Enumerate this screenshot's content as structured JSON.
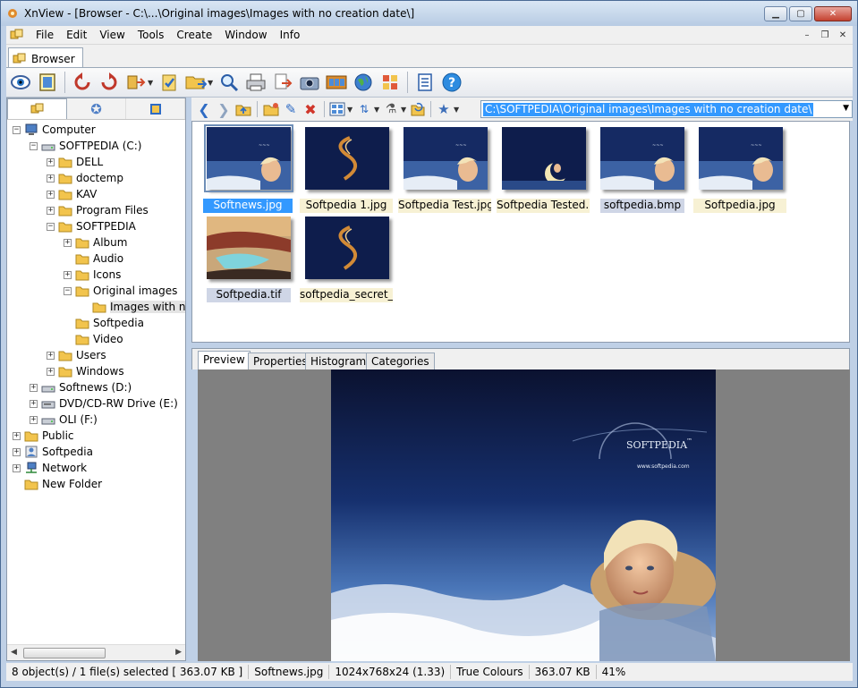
{
  "window": {
    "title": "XnView - [Browser - C:\\...\\Original images\\Images with no creation date\\]",
    "min_label": "▁",
    "max_label": "▢",
    "close_label": "✕"
  },
  "menu": [
    "File",
    "Edit",
    "View",
    "Tools",
    "Create",
    "Window",
    "Info"
  ],
  "doc_tab": {
    "label": "Browser"
  },
  "toolbar": {
    "buttons": [
      "eye-icon",
      "fullscreen-icon",
      "rotate-left-icon",
      "rotate-right-icon",
      "convert-icon",
      "checkmark-icon",
      "open-folder-icon",
      "zoom-icon",
      "print-icon",
      "export-icon",
      "camera-icon",
      "filmstrip-icon",
      "globe-icon",
      "mosaic-icon",
      "properties-icon",
      "help-icon"
    ]
  },
  "nav": {
    "path": "C:\\SOFTPEDIA\\Original images\\Images with no creation date\\"
  },
  "tree": [
    {
      "label": "Computer",
      "level": 0,
      "exp": "-",
      "icon": "computer-icon"
    },
    {
      "label": "SOFTPEDIA (C:)",
      "level": 1,
      "exp": "-",
      "icon": "drive-icon"
    },
    {
      "label": "DELL",
      "level": 2,
      "exp": "+",
      "icon": "folder-icon"
    },
    {
      "label": "doctemp",
      "level": 2,
      "exp": "+",
      "icon": "folder-icon"
    },
    {
      "label": "KAV",
      "level": 2,
      "exp": "+",
      "icon": "folder-icon"
    },
    {
      "label": "Program Files",
      "level": 2,
      "exp": "+",
      "icon": "folder-icon"
    },
    {
      "label": "SOFTPEDIA",
      "level": 2,
      "exp": "-",
      "icon": "folder-icon"
    },
    {
      "label": "Album",
      "level": 3,
      "exp": "+",
      "icon": "folder-icon"
    },
    {
      "label": "Audio",
      "level": 3,
      "exp": "",
      "icon": "folder-icon"
    },
    {
      "label": "Icons",
      "level": 3,
      "exp": "+",
      "icon": "folder-icon"
    },
    {
      "label": "Original images",
      "level": 3,
      "exp": "-",
      "icon": "folder-icon"
    },
    {
      "label": "Images with n",
      "level": 4,
      "exp": "",
      "icon": "folder-icon",
      "selected": true
    },
    {
      "label": "Softpedia",
      "level": 3,
      "exp": "",
      "icon": "folder-icon"
    },
    {
      "label": "Video",
      "level": 3,
      "exp": "",
      "icon": "folder-icon"
    },
    {
      "label": "Users",
      "level": 2,
      "exp": "+",
      "icon": "folder-icon"
    },
    {
      "label": "Windows",
      "level": 2,
      "exp": "+",
      "icon": "folder-icon"
    },
    {
      "label": "Softnews (D:)",
      "level": 1,
      "exp": "+",
      "icon": "drive-icon"
    },
    {
      "label": "DVD/CD-RW Drive (E:)",
      "level": 1,
      "exp": "+",
      "icon": "dvd-icon"
    },
    {
      "label": "OLI (F:)",
      "level": 1,
      "exp": "+",
      "icon": "drive-icon"
    },
    {
      "label": "Public",
      "level": 0,
      "exp": "+",
      "icon": "folder-icon"
    },
    {
      "label": "Softpedia",
      "level": 0,
      "exp": "+",
      "icon": "user-folder-icon"
    },
    {
      "label": "Network",
      "level": 0,
      "exp": "+",
      "icon": "network-icon"
    },
    {
      "label": "New Folder",
      "level": 0,
      "exp": "",
      "icon": "folder-icon"
    }
  ],
  "thumbnails": [
    {
      "label": "Softnews.jpg",
      "state": "sel",
      "art": "portrait"
    },
    {
      "label": "Softpedia 1.jpg",
      "state": "",
      "art": "swirl"
    },
    {
      "label": "Softpedia Test.jpg",
      "state": "",
      "art": "portrait"
    },
    {
      "label": "Softpedia Tested....",
      "state": "",
      "art": "moon"
    },
    {
      "label": "softpedia.bmp",
      "state": "bmp",
      "art": "portrait"
    },
    {
      "label": "Softpedia.jpg",
      "state": "",
      "art": "portrait"
    },
    {
      "label": "Softpedia.tif",
      "state": "bmp",
      "art": "beach"
    },
    {
      "label": "softpedia_secret_...",
      "state": "",
      "art": "swirl"
    }
  ],
  "preview_tabs": [
    "Preview",
    "Properties",
    "Histogram",
    "Categories"
  ],
  "preview": {
    "brand": "SOFTPEDIA",
    "tm": "™",
    "url": "www.softpedia.com"
  },
  "status": {
    "objects": "8 object(s) / 1 file(s) selected  [ 363.07 KB ]",
    "filename": "Softnews.jpg",
    "dimensions": "1024x768x24 (1.33)",
    "colours": "True Colours",
    "size": "363.07 KB",
    "zoom": "41%"
  }
}
